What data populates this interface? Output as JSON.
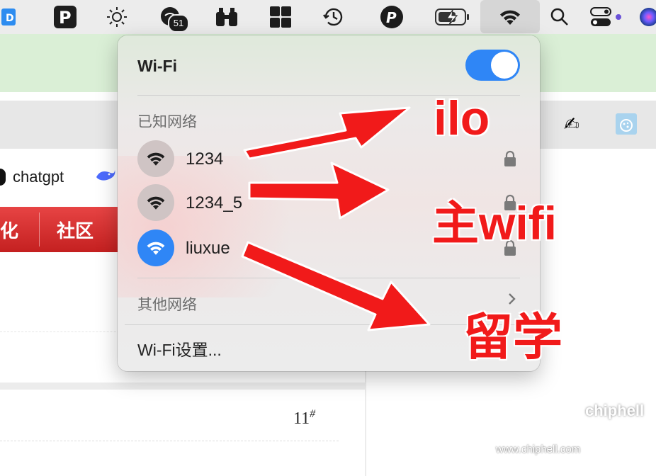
{
  "menubar": {
    "icons": [
      "dropzone-icon",
      "p-app-icon",
      "brightness-icon",
      "chat-icon",
      "binoculars-icon",
      "grid-icon",
      "time-machine-icon",
      "pasty-icon",
      "battery-charging-icon",
      "wifi-icon",
      "search-icon",
      "control-center-icon",
      "siri-icon"
    ],
    "badge_count": "51"
  },
  "browser": {
    "bookmark_chatgpt": "chatgpt",
    "nav_items": [
      "化",
      "社区"
    ],
    "post_number": "11",
    "post_number_mark": "#"
  },
  "wifi_menu": {
    "title": "Wi-Fi",
    "enabled": true,
    "known_label": "已知网络",
    "networks": [
      {
        "name": "1234",
        "secured": true,
        "connected": false
      },
      {
        "name": "1234_5",
        "secured": true,
        "connected": false
      },
      {
        "name": "liuxue",
        "secured": true,
        "connected": true
      }
    ],
    "other_label": "其他网络",
    "settings_label": "Wi-Fi设置..."
  },
  "annotations": {
    "label_1": "ilo",
    "label_2": "主wifi",
    "label_3": "留学",
    "color": "#f11a1a"
  },
  "watermark": {
    "logo": "chiphell",
    "url": "www.chiphell.com"
  }
}
